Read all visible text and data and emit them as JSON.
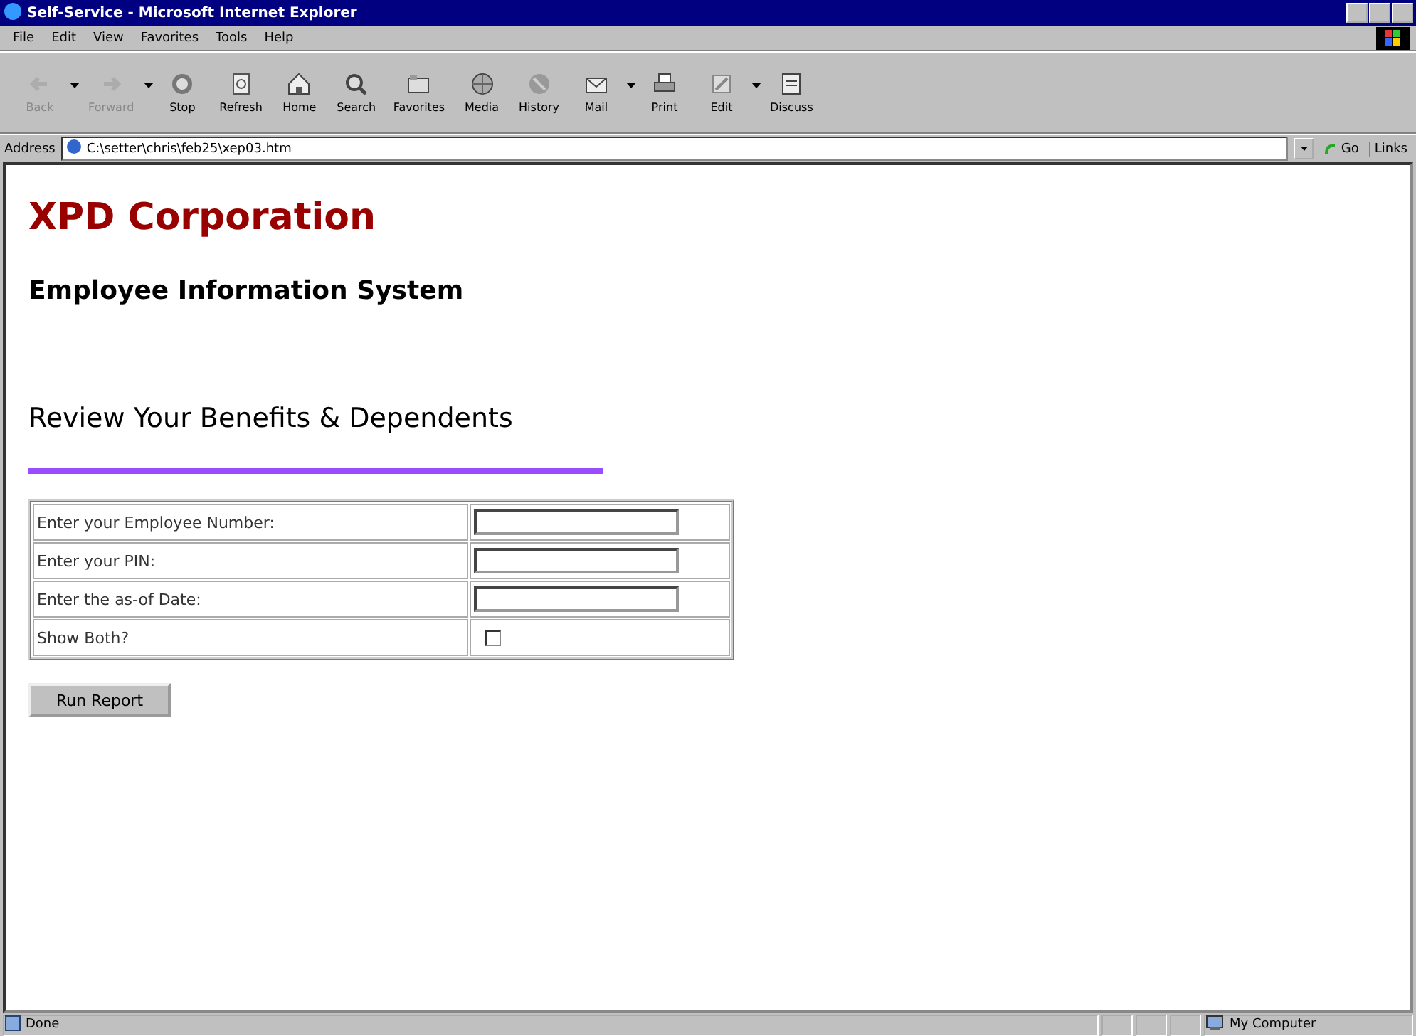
{
  "window": {
    "title": "Self-Service - Microsoft Internet Explorer"
  },
  "menu": [
    "File",
    "Edit",
    "View",
    "Favorites",
    "Tools",
    "Help"
  ],
  "toolbar": [
    {
      "label": "Back",
      "disabled": true,
      "dropdown": true
    },
    {
      "label": "Forward",
      "disabled": true,
      "dropdown": true
    },
    {
      "label": "Stop",
      "disabled": false,
      "dropdown": false
    },
    {
      "label": "Refresh",
      "disabled": false,
      "dropdown": false
    },
    {
      "label": "Home",
      "disabled": false,
      "dropdown": false
    },
    {
      "label": "Search",
      "disabled": false,
      "dropdown": false
    },
    {
      "label": "Favorites",
      "disabled": false,
      "dropdown": false
    },
    {
      "label": "Media",
      "disabled": false,
      "dropdown": false
    },
    {
      "label": "History",
      "disabled": false,
      "dropdown": false
    },
    {
      "label": "Mail",
      "disabled": false,
      "dropdown": true
    },
    {
      "label": "Print",
      "disabled": false,
      "dropdown": false
    },
    {
      "label": "Edit",
      "disabled": false,
      "dropdown": true
    },
    {
      "label": "Discuss",
      "disabled": false,
      "dropdown": false
    }
  ],
  "address_bar": {
    "label": "Address",
    "value": "C:\\setter\\chris\\feb25\\xep03.htm",
    "go": "Go",
    "links": "Links"
  },
  "page": {
    "company": "XPD Corporation",
    "system": "Employee Information System",
    "heading": "Review Your Benefits & Dependents",
    "form": [
      {
        "kind": "text",
        "label": "Enter your Employee Number:"
      },
      {
        "kind": "text",
        "label": "Enter your PIN:"
      },
      {
        "kind": "text",
        "label": "Enter the as-of Date:"
      },
      {
        "kind": "checkbox",
        "label": "Show Both?",
        "checked": false
      }
    ],
    "button": "Run Report"
  },
  "status_bar": {
    "text": "Done",
    "zone": "My Computer"
  }
}
